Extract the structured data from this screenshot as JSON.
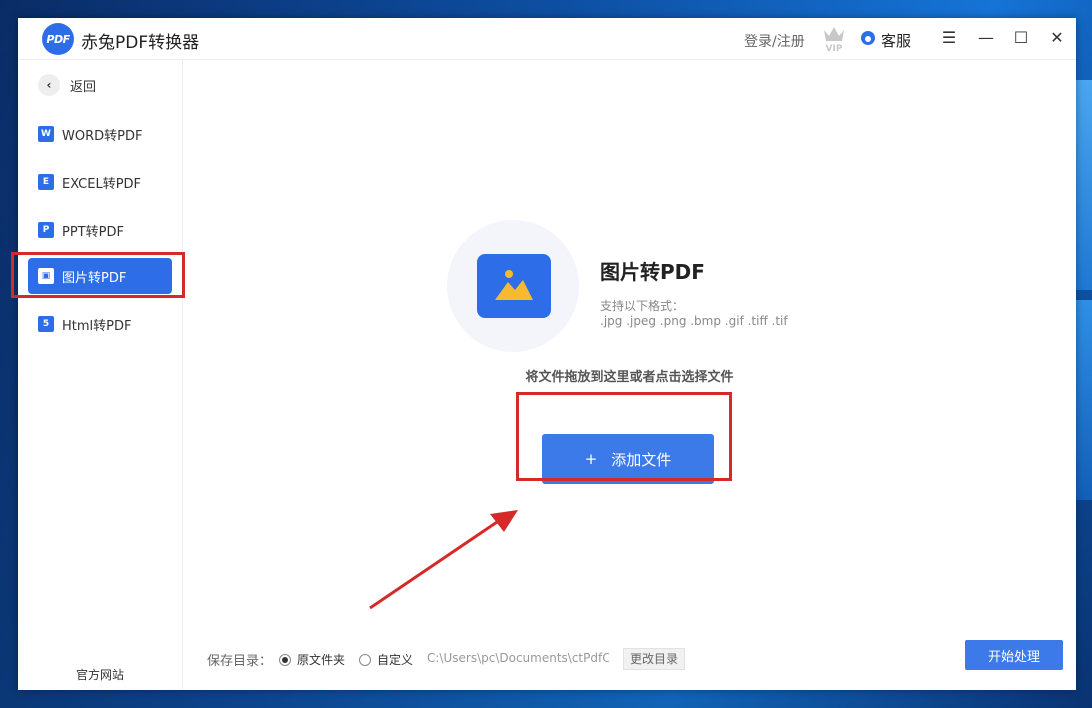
{
  "app": {
    "title": "赤兔PDF转换器",
    "logo_text": "PDF",
    "login_label": "登录/注册",
    "vip_label": "VIP",
    "service_label": "客服",
    "menu_glyph": "☰",
    "minimize_glyph": "—",
    "maximize_glyph": "☐",
    "close_glyph": "✕"
  },
  "sidebar": {
    "back_label": "返回",
    "items": [
      {
        "label": "WORD转PDF",
        "icon": "W"
      },
      {
        "label": "EXCEL转PDF",
        "icon": "E"
      },
      {
        "label": "PPT转PDF",
        "icon": "P"
      },
      {
        "label": "图片转PDF",
        "icon": "▣",
        "active": true
      },
      {
        "label": "Html转PDF",
        "icon": "5"
      }
    ],
    "official_site": "官方网站"
  },
  "main": {
    "section_title": "图片转PDF",
    "formats_label": "支持以下格式：",
    "formats": ".jpg .jpeg .png .bmp .gif .tiff .tif",
    "drop_hint": "将文件拖放到这里或者点击选择文件",
    "add_button_plus": "+",
    "add_button_label": "添加文件"
  },
  "footer": {
    "save_label": "保存目录：",
    "option_original": "原文件夹",
    "option_custom": "自定义",
    "path": "C:\\Users\\pc\\Documents\\ctPdfConverter",
    "change_dir": "更改目录",
    "start_button": "开始处理"
  },
  "colors": {
    "accent": "#2d6ee8",
    "annotation": "#d62a2a"
  }
}
